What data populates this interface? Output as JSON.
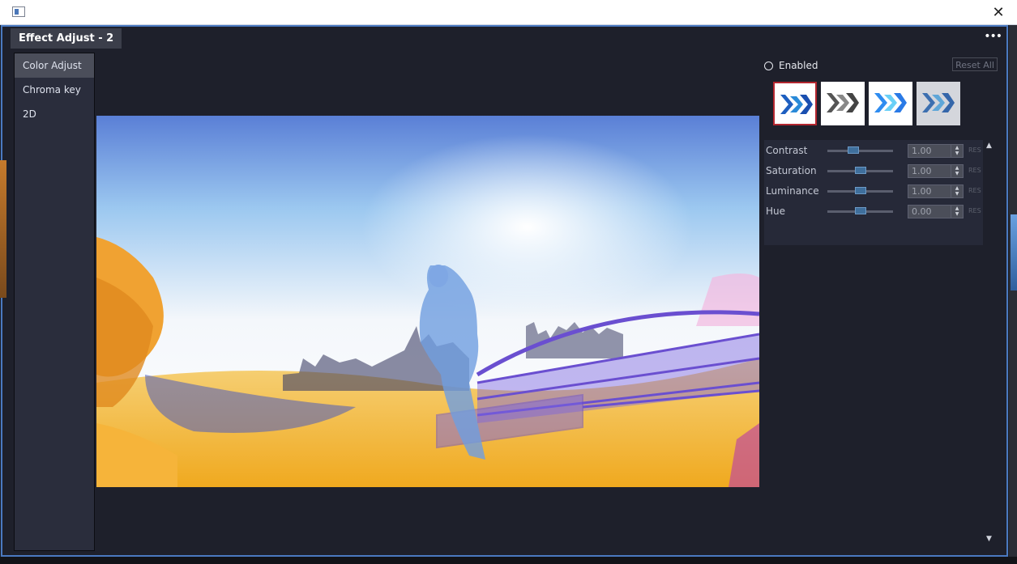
{
  "window": {
    "close_glyph": "✕"
  },
  "tab": {
    "title": "Effect Adjust - 2",
    "more_glyph": "•••"
  },
  "left_panel": {
    "items": [
      {
        "label": "Color Adjust",
        "active": true
      },
      {
        "label": "Chroma key",
        "active": false
      },
      {
        "label": "2D",
        "active": false
      }
    ]
  },
  "preview": {
    "icon": "video-preview-image"
  },
  "controls": {
    "enabled_label": "Enabled",
    "reset_label": "Reset All",
    "presets": [
      {
        "name": "color-preset",
        "selected": true
      },
      {
        "name": "grayscale-preset",
        "selected": false
      },
      {
        "name": "bright-preset",
        "selected": false
      },
      {
        "name": "muted-preset",
        "selected": false
      }
    ],
    "params": [
      {
        "label": "Contrast",
        "value": "1.00",
        "slider": 0.37,
        "reset": "RES"
      },
      {
        "label": "Saturation",
        "value": "1.00",
        "slider": 0.5,
        "reset": "RES"
      },
      {
        "label": "Luminance",
        "value": "1.00",
        "slider": 0.5,
        "reset": "RES"
      },
      {
        "label": "Hue",
        "value": "0.00",
        "slider": 0.5,
        "reset": "RES"
      }
    ]
  },
  "scrollbar": {
    "up_glyph": "▲",
    "down_glyph": "▼"
  },
  "colors": {
    "accent": "#4a79c0",
    "selected_border": "#b3262f",
    "panel_bg": "#1e202b"
  }
}
